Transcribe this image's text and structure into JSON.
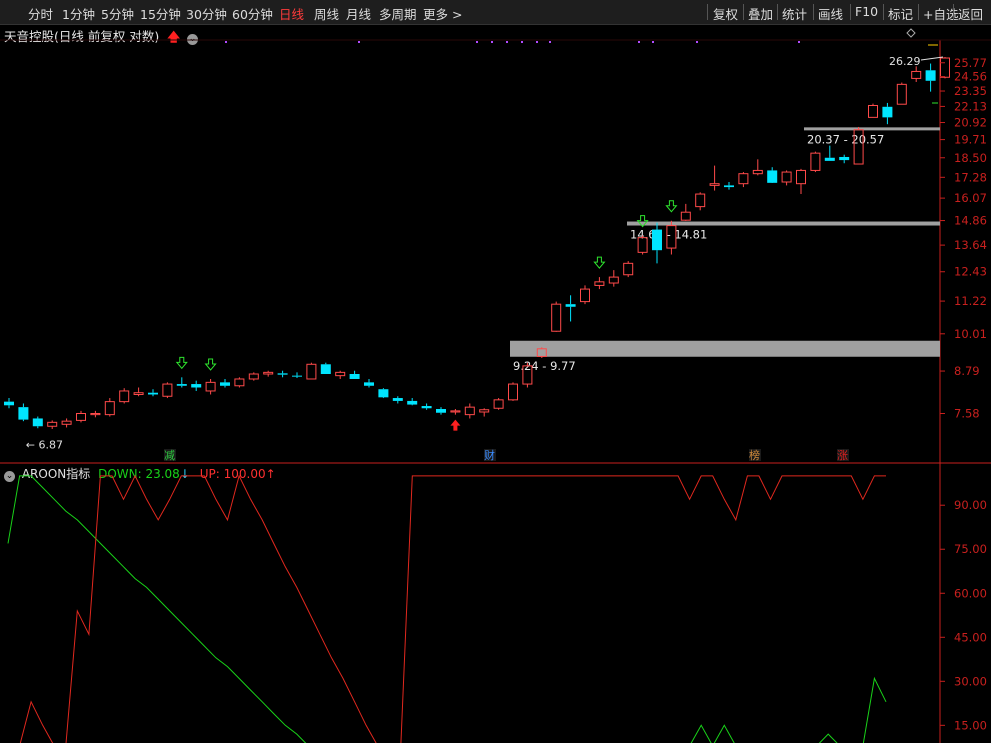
{
  "toolbar": {
    "periods": [
      "分时",
      "1分钟",
      "5分钟",
      "15分钟",
      "30分钟",
      "60分钟",
      "日线",
      "周线",
      "月线",
      "多周期",
      "更多 >"
    ],
    "active_period": "日线",
    "right_buttons": [
      "复权",
      "叠加",
      "统计",
      "画线",
      "F10",
      "标记",
      "+自选",
      "返回"
    ]
  },
  "header": {
    "title": "天音控股(日线 前复权 对数)"
  },
  "indicator": {
    "name": "AROON指标",
    "down_label": "DOWN: 23.08",
    "up_label": "UP: 100.00"
  },
  "colors": {
    "up": "#ff4a4a",
    "down": "#00e5ff",
    "aroon_down": "#19d219",
    "aroon_up": "#e0281e",
    "axis": "#c8201e"
  },
  "price_axis": {
    "ticks": [
      "25.77",
      "24.56",
      "23.35",
      "22.13",
      "20.92",
      "19.71",
      "18.50",
      "17.28",
      "16.07",
      "14.86",
      "13.64",
      "12.43",
      "11.22",
      "10.01",
      "8.79",
      "7.58"
    ],
    "log_scale": true
  },
  "indicator_axis": {
    "ticks": [
      "90.00",
      "75.00",
      "60.00",
      "45.00",
      "30.00",
      "15.00"
    ]
  },
  "annotations": {
    "low_label": "6.87",
    "high_label": "26.29",
    "gaps": [
      {
        "label": "9.24 - 9.77",
        "low": 9.24,
        "high": 9.77
      },
      {
        "label": "14.61 - 14.81",
        "low": 14.61,
        "high": 14.81
      },
      {
        "label": "20.37 - 20.57",
        "low": 20.37,
        "high": 20.57
      }
    ],
    "markers": [
      {
        "text": "减",
        "color": "#2ecc40"
      },
      {
        "text": "财",
        "color": "#3a8cff"
      },
      {
        "text": "榜",
        "color": "#d08a3a"
      },
      {
        "text": "涨",
        "color": "#e02020"
      }
    ]
  },
  "chart_data": [
    {
      "type": "candlestick",
      "title": "天音控股(日线 前复权 对数)",
      "fields": [
        "open",
        "high",
        "low",
        "close"
      ],
      "candles": [
        [
          7.9,
          8.0,
          7.72,
          7.8
        ],
        [
          7.75,
          7.85,
          7.38,
          7.42
        ],
        [
          7.45,
          7.5,
          7.2,
          7.25
        ],
        [
          7.25,
          7.4,
          7.18,
          7.35
        ],
        [
          7.3,
          7.45,
          7.22,
          7.38
        ],
        [
          7.4,
          7.65,
          7.35,
          7.58
        ],
        [
          7.55,
          7.65,
          7.48,
          7.58
        ],
        [
          7.55,
          8.0,
          7.5,
          7.9
        ],
        [
          7.9,
          8.28,
          7.85,
          8.2
        ],
        [
          8.1,
          8.3,
          8.05,
          8.15
        ],
        [
          8.15,
          8.25,
          8.05,
          8.1
        ],
        [
          8.05,
          8.45,
          8.0,
          8.4
        ],
        [
          8.4,
          8.6,
          8.3,
          8.35
        ],
        [
          8.4,
          8.5,
          8.2,
          8.3
        ],
        [
          8.2,
          8.55,
          8.1,
          8.45
        ],
        [
          8.45,
          8.55,
          8.3,
          8.35
        ],
        [
          8.35,
          8.6,
          8.3,
          8.55
        ],
        [
          8.55,
          8.75,
          8.5,
          8.7
        ],
        [
          8.7,
          8.8,
          8.62,
          8.75
        ],
        [
          8.72,
          8.8,
          8.6,
          8.68
        ],
        [
          8.65,
          8.75,
          8.58,
          8.62
        ],
        [
          8.55,
          9.05,
          8.55,
          9.0
        ],
        [
          9.0,
          9.05,
          8.7,
          8.7
        ],
        [
          8.65,
          8.8,
          8.55,
          8.75
        ],
        [
          8.7,
          8.8,
          8.55,
          8.55
        ],
        [
          8.45,
          8.55,
          8.3,
          8.35
        ],
        [
          8.25,
          8.28,
          8.0,
          8.02
        ],
        [
          8.0,
          8.05,
          7.85,
          7.92
        ],
        [
          7.92,
          8.0,
          7.8,
          7.82
        ],
        [
          7.78,
          7.85,
          7.68,
          7.72
        ],
        [
          7.7,
          7.75,
          7.55,
          7.6
        ],
        [
          7.62,
          7.7,
          7.55,
          7.65
        ],
        [
          7.55,
          7.85,
          7.45,
          7.75
        ],
        [
          7.62,
          7.72,
          7.5,
          7.68
        ],
        [
          7.72,
          8.0,
          7.68,
          7.95
        ],
        [
          7.95,
          8.45,
          7.92,
          8.4
        ],
        [
          8.4,
          9.05,
          8.3,
          8.95
        ],
        [
          9.25,
          9.55,
          9.2,
          9.5
        ],
        [
          10.1,
          11.2,
          10.08,
          11.1
        ],
        [
          11.1,
          11.45,
          10.45,
          11.0
        ],
        [
          11.2,
          11.85,
          11.1,
          11.7
        ],
        [
          11.85,
          12.2,
          11.7,
          12.0
        ],
        [
          11.95,
          12.5,
          11.8,
          12.2
        ],
        [
          12.3,
          12.9,
          12.2,
          12.8
        ],
        [
          13.3,
          14.1,
          13.2,
          14.0
        ],
        [
          14.4,
          14.75,
          12.8,
          13.4
        ],
        [
          13.5,
          14.85,
          13.2,
          14.6
        ],
        [
          14.88,
          15.75,
          14.84,
          15.3
        ],
        [
          15.6,
          16.4,
          15.4,
          16.3
        ],
        [
          16.8,
          18.0,
          16.5,
          16.9
        ],
        [
          16.8,
          17.0,
          16.55,
          16.7
        ],
        [
          16.9,
          17.6,
          16.7,
          17.5
        ],
        [
          17.5,
          18.4,
          17.4,
          17.7
        ],
        [
          17.7,
          17.9,
          17.05,
          16.95
        ],
        [
          17.0,
          17.7,
          16.8,
          17.6
        ],
        [
          16.9,
          17.8,
          16.3,
          17.7
        ],
        [
          17.7,
          18.9,
          17.6,
          18.8
        ],
        [
          18.5,
          19.3,
          18.3,
          18.3
        ],
        [
          18.55,
          18.7,
          18.15,
          18.35
        ],
        [
          18.1,
          20.6,
          18.1,
          20.4
        ],
        [
          21.3,
          22.35,
          21.3,
          22.2
        ],
        [
          22.1,
          22.4,
          20.8,
          21.3
        ],
        [
          22.3,
          24.05,
          22.3,
          23.9
        ],
        [
          24.4,
          25.45,
          24.1,
          25.0
        ],
        [
          25.1,
          25.7,
          23.3,
          24.2
        ],
        [
          24.5,
          26.29,
          24.4,
          26.2
        ]
      ],
      "low_label": 6.87,
      "high_label": 26.29,
      "y_log": true
    },
    {
      "type": "line",
      "title": "AROON指标",
      "ylim": [
        10,
        102
      ],
      "series": [
        {
          "name": "DOWN",
          "values": [
            77,
            100,
            100,
            96,
            92,
            88,
            85,
            81,
            77,
            73,
            69,
            65,
            62,
            58,
            54,
            50,
            46,
            42,
            38,
            35,
            31,
            27,
            23,
            19,
            15,
            12,
            8,
            8,
            8,
            8,
            8,
            8,
            8,
            8,
            8,
            8,
            8,
            8,
            8,
            8,
            8,
            8,
            8,
            8,
            8,
            8,
            8,
            8,
            8,
            8,
            8,
            8,
            8,
            8,
            8,
            8,
            8,
            8,
            8,
            8,
            15,
            8,
            15,
            8,
            8,
            8,
            8,
            8,
            8,
            8,
            8,
            12,
            8,
            8,
            8,
            31,
            23
          ]
        },
        {
          "name": "UP",
          "values": [
            8,
            8,
            23,
            15,
            8,
            8,
            54,
            46,
            100,
            100,
            92,
            100,
            92,
            85,
            92,
            100,
            100,
            100,
            92,
            85,
            100,
            92,
            85,
            77,
            69,
            62,
            54,
            46,
            38,
            31,
            23,
            15,
            8,
            8,
            8,
            100,
            100,
            100,
            100,
            100,
            100,
            100,
            100,
            100,
            100,
            100,
            100,
            100,
            100,
            100,
            100,
            100,
            100,
            100,
            100,
            100,
            100,
            100,
            100,
            92,
            100,
            100,
            92,
            85,
            100,
            100,
            92,
            100,
            100,
            100,
            100,
            100,
            100,
            100,
            92,
            100,
            100
          ]
        }
      ],
      "current": {
        "DOWN": 23.08,
        "UP": 100.0
      }
    }
  ]
}
